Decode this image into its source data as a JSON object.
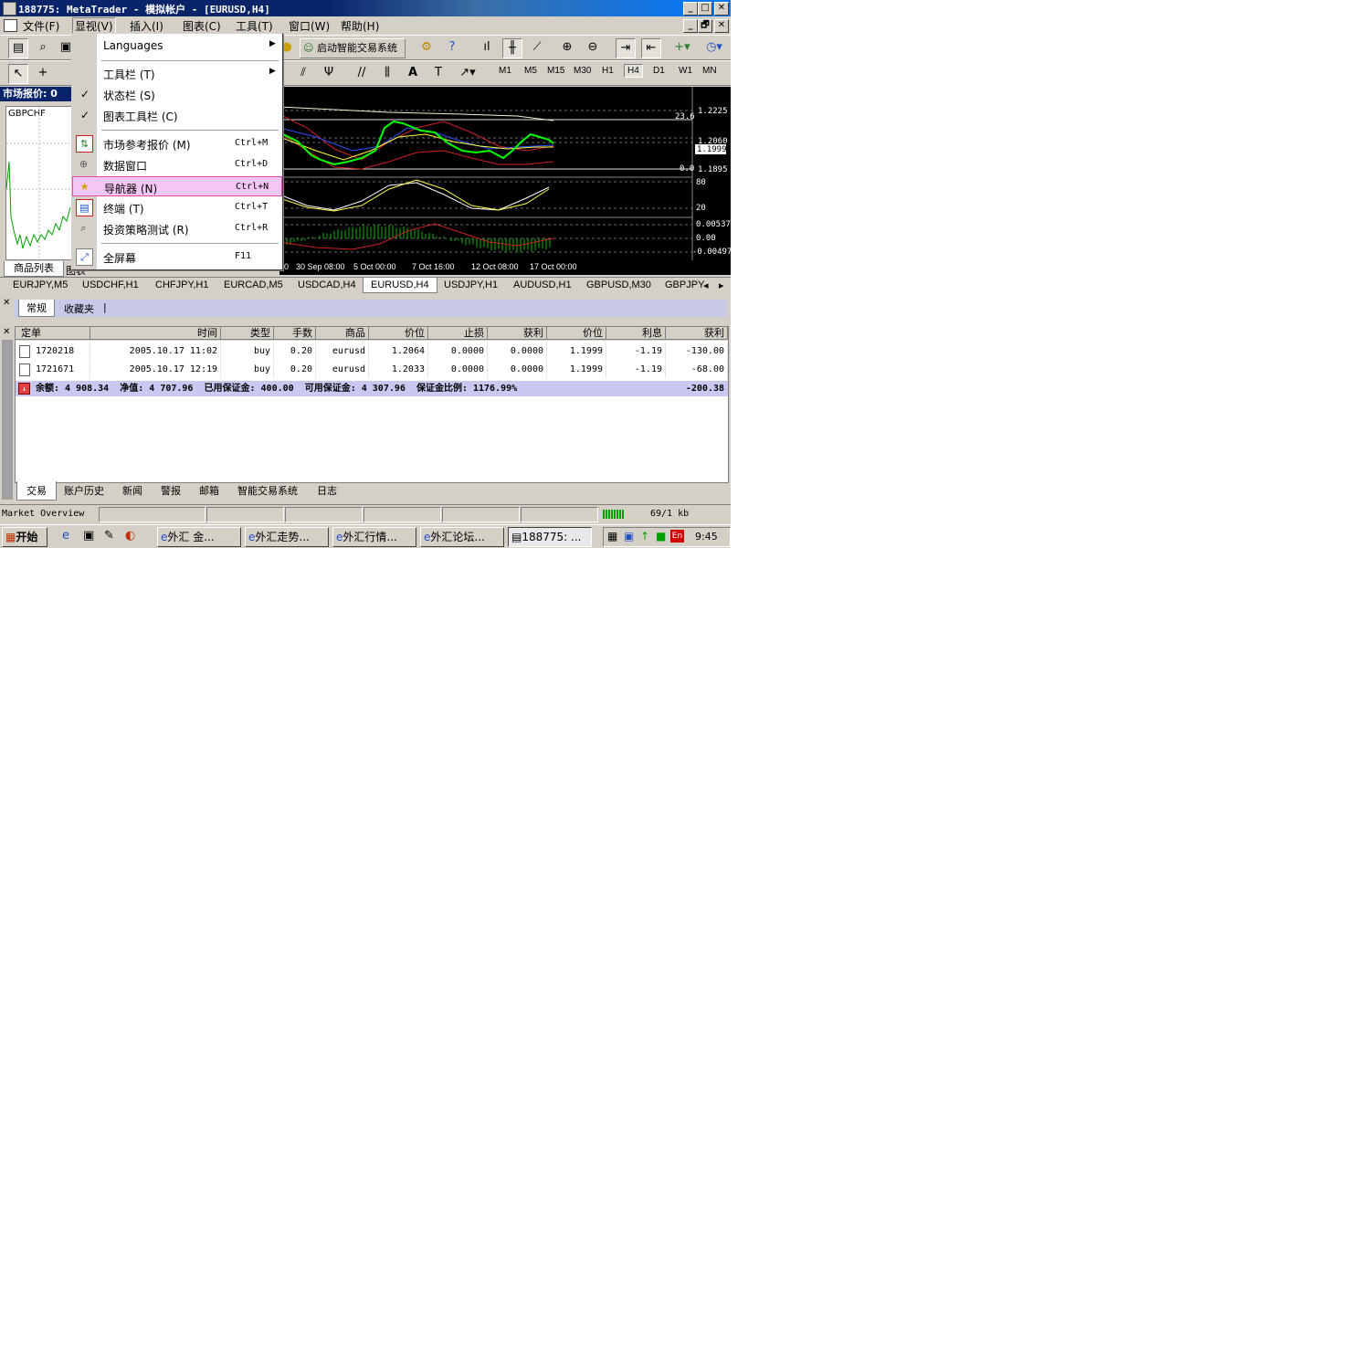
{
  "window": {
    "title": "188775: MetaTrader - 模拟帐户 - [EURUSD,H4]",
    "controls": {
      "minimize": "_",
      "maximize": "□",
      "close": "✕",
      "restore": "🗗"
    }
  },
  "menubar": {
    "items": [
      "文件(F)",
      "显视(V)",
      "插入(I)",
      "图表(C)",
      "工具(T)",
      "窗口(W)",
      "帮助(H)"
    ]
  },
  "toolbar": {
    "expert_button": "启动智能交易系统",
    "timeframes": [
      "M1",
      "M5",
      "M15",
      "M30",
      "H1",
      "H4",
      "D1",
      "W1",
      "MN"
    ],
    "selected_timeframe": "H4"
  },
  "view_menu": {
    "items": [
      {
        "label": "Languages",
        "shortcut": "",
        "submenu": true
      },
      {
        "label": "工具栏 (T)",
        "shortcut": "",
        "submenu": true
      },
      {
        "label": "状态栏 (S)",
        "shortcut": "",
        "checked": true
      },
      {
        "label": "图表工具栏 (C)",
        "shortcut": "",
        "checked": true
      },
      {
        "label": "市场参考报价 (M)",
        "shortcut": "Ctrl+M",
        "icon": "market-watch-icon"
      },
      {
        "label": "数据窗口",
        "shortcut": "Ctrl+D",
        "icon": "data-window-icon"
      },
      {
        "label": "导航器 (N)",
        "shortcut": "Ctrl+N",
        "icon": "navigator-icon",
        "highlighted": true
      },
      {
        "label": "终端 (T)",
        "shortcut": "Ctrl+T",
        "icon": "terminal-icon"
      },
      {
        "label": "投资策略测试 (R)",
        "shortcut": "Ctrl+R",
        "icon": "tester-icon"
      },
      {
        "label": "全屏幕",
        "shortcut": "F11",
        "icon": "fullscreen-icon"
      }
    ]
  },
  "market_watch": {
    "title": "市场报价: 0",
    "chart_symbol": "GBPCHF",
    "tabs": [
      "商品列表",
      "图表"
    ]
  },
  "chart": {
    "price_labels": [
      "1.2225",
      "1.2060",
      "1.1999",
      "1.1895"
    ],
    "fib_labels": [
      "23.6",
      "0.0"
    ],
    "stoch_labels": [
      "80",
      "20"
    ],
    "macd_labels": [
      "0.00537",
      "0.00",
      "-0.00497"
    ],
    "date_labels": [
      "00",
      "30 Sep 08:00",
      "5 Oct 00:00",
      "7 Oct 16:00",
      "12 Oct 08:00",
      "17 Oct 00:00"
    ],
    "current_price": "1.1999"
  },
  "symbol_tabs": {
    "items": [
      "EURJPY,M5",
      "USDCHF,H1",
      "CHFJPY,H1",
      "EURCAD,M5",
      "USDCAD,H4",
      "EURUSD,H4",
      "USDJPY,H1",
      "AUDUSD,H1",
      "GBPUSD,M30",
      "GBPJPY"
    ],
    "active": "EURUSD,H4"
  },
  "navigator": {
    "tabs": [
      "常规",
      "收藏夹"
    ]
  },
  "terminal": {
    "columns": [
      "定单",
      "时间",
      "类型",
      "手数",
      "商品",
      "价位",
      "止损",
      "获利",
      "价位",
      "利息",
      "获利"
    ],
    "rows": [
      [
        "1720218",
        "2005.10.17 11:02",
        "buy",
        "0.20",
        "eurusd",
        "1.2064",
        "0.0000",
        "0.0000",
        "1.1999",
        "-1.19",
        "-130.00"
      ],
      [
        "1721671",
        "2005.10.17 12:19",
        "buy",
        "0.20",
        "eurusd",
        "1.2033",
        "0.0000",
        "0.0000",
        "1.1999",
        "-1.19",
        "-68.00"
      ]
    ],
    "summary": "余额: 4 908.34  净值: 4 707.96  已用保证金: 400.00  可用保证金: 4 307.96  保证金比例: 1176.99%",
    "summary_total": "-200.38",
    "tabs": [
      "交易",
      "账户历史",
      "新闻",
      "警报",
      "邮箱",
      "智能交易系统",
      "日志"
    ]
  },
  "statusbar": {
    "left": "Market Overview",
    "traffic": "69/1 kb"
  },
  "taskbar": {
    "start": "开始",
    "windows": [
      "外汇 金...",
      "外汇走势...",
      "外汇行情...",
      "外汇论坛...",
      "188775: ..."
    ],
    "ime": "En",
    "clock": "9:45"
  }
}
